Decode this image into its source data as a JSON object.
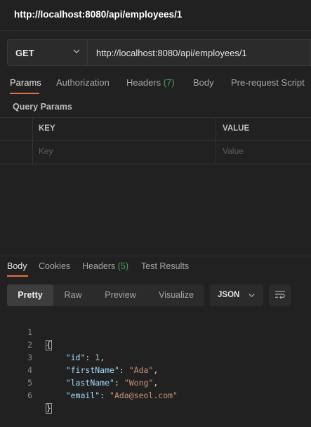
{
  "window": {
    "title": "http://localhost:8080/api/employees/1"
  },
  "request": {
    "method": "GET",
    "url": "http://localhost:8080/api/employees/1"
  },
  "request_tabs": [
    {
      "label": "Params",
      "active": true
    },
    {
      "label": "Authorization"
    },
    {
      "label": "Headers",
      "count": "(7)"
    },
    {
      "label": "Body"
    },
    {
      "label": "Pre-request Script"
    }
  ],
  "query_params": {
    "title": "Query Params",
    "columns": [
      "KEY",
      "VALUE"
    ],
    "placeholders": {
      "key": "Key",
      "value": "Value"
    }
  },
  "response_tabs": [
    {
      "label": "Body",
      "active": true
    },
    {
      "label": "Cookies"
    },
    {
      "label": "Headers",
      "count": "(5)"
    },
    {
      "label": "Test Results"
    }
  ],
  "view_modes": [
    {
      "label": "Pretty",
      "active": true
    },
    {
      "label": "Raw"
    },
    {
      "label": "Preview"
    },
    {
      "label": "Visualize"
    }
  ],
  "format": {
    "selected": "JSON"
  },
  "icons": {
    "method_dropdown": "chevron-down-icon",
    "format_dropdown": "chevron-down-icon",
    "wrap": "wrap-lines-icon"
  },
  "colors": {
    "accent": "#f26b3a",
    "count": "#40a960"
  },
  "response_body": {
    "line_numbers": [
      "1",
      "2",
      "3",
      "4",
      "5",
      "6"
    ],
    "open_brace": "{",
    "close_brace": "}",
    "fields": [
      {
        "key": "\"id\"",
        "value": "1",
        "value_type": "number"
      },
      {
        "key": "\"firstName\"",
        "value": "\"Ada\"",
        "value_type": "string"
      },
      {
        "key": "\"lastName\"",
        "value": "\"Wong\"",
        "value_type": "string"
      },
      {
        "key": "\"email\"",
        "value": "\"Ada@seol.com\"",
        "value_type": "string"
      }
    ]
  }
}
